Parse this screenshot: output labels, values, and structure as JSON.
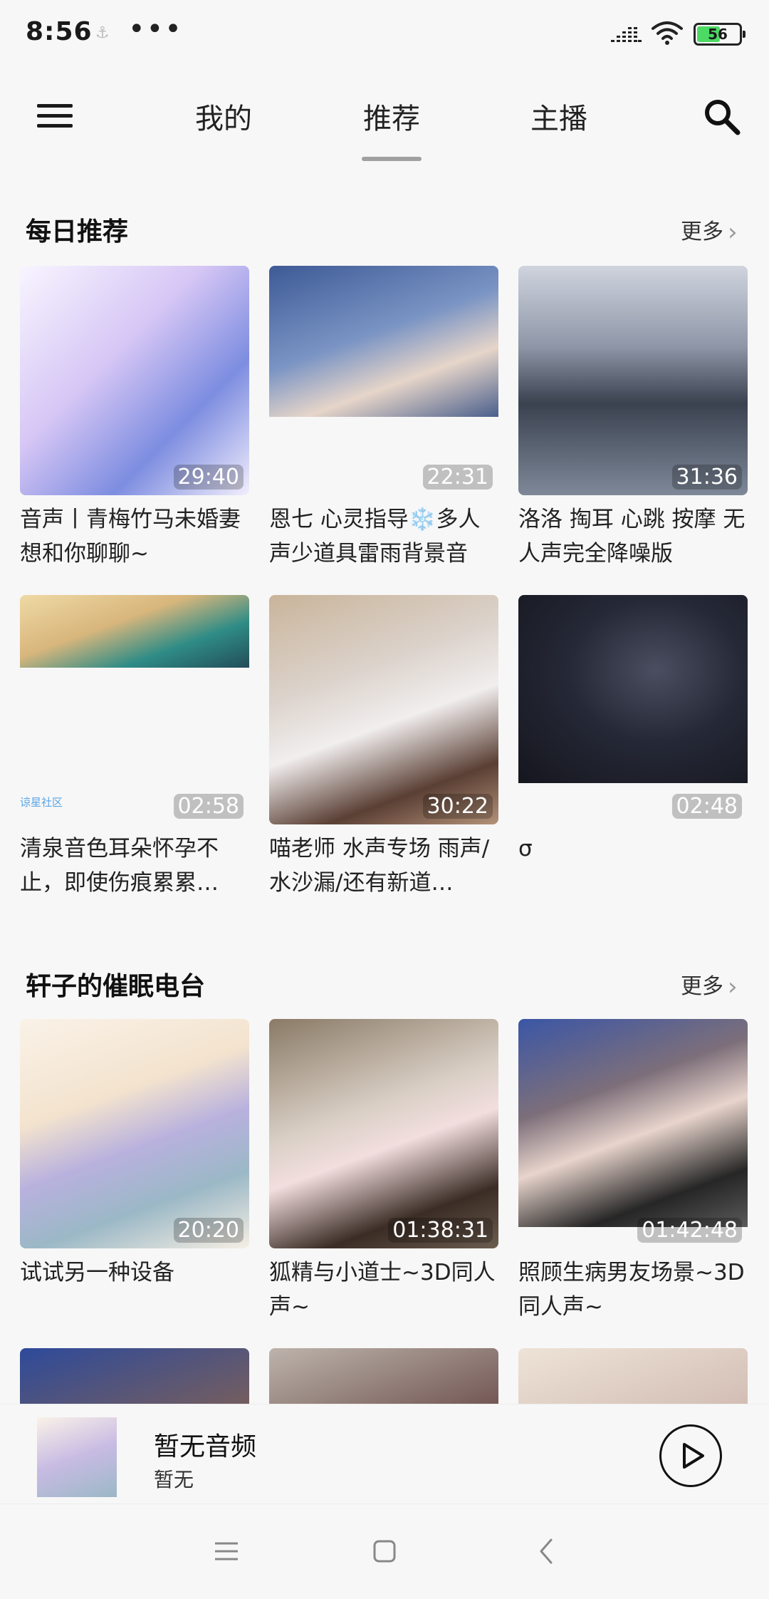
{
  "status_bar": {
    "time": "8:56",
    "notif_glyph": "⚓",
    "dots": "•••",
    "battery_level": "56",
    "battery_fraction": 0.56
  },
  "nav": {
    "tabs": [
      "我的",
      "推荐",
      "主播"
    ],
    "active_tab": "推荐"
  },
  "sections": [
    {
      "title": "每日推荐",
      "more_label": "更多",
      "items": [
        {
          "title": "音声丨青梅竹马未婚妻想和你聊聊~",
          "duration": "29:40"
        },
        {
          "title": "恩七 心灵指导❄️多人声少道具雷雨背景音",
          "duration": "22:31"
        },
        {
          "title": "洛洛 掏耳 心跳 按摩 无人声完全降噪版",
          "duration": "31:36"
        },
        {
          "title": "清泉音色耳朵怀孕不止，即使伤痕累累…",
          "duration": "02:58"
        },
        {
          "title": "喵老师 水声专场 雨声/水沙漏/还有新道…",
          "duration": "30:22"
        },
        {
          "title": "σ",
          "duration": "02:48"
        }
      ]
    },
    {
      "title": "轩子的催眠电台",
      "more_label": "更多",
      "items": [
        {
          "title": "试试另一种设备",
          "duration": "20:20"
        },
        {
          "title": "狐精与小道士~3D同人声~",
          "duration": "01:38:31"
        },
        {
          "title": "照顾生病男友场景~3D同人声~",
          "duration": "01:42:48"
        }
      ]
    }
  ],
  "watermark": "谅星社区",
  "player": {
    "title": "暂无音频",
    "subtitle": "暂无"
  },
  "colors": {
    "background": "#f7f7f7",
    "text": "#1a1a1a",
    "tab_indicator": "#a0a0a0",
    "battery": "#4cd964"
  },
  "icons": [
    "menu-icon",
    "search-icon",
    "chevron-right-icon",
    "play-icon",
    "signal-icon",
    "wifi-icon",
    "battery-icon",
    "recent-apps-icon",
    "home-icon",
    "back-icon"
  ]
}
